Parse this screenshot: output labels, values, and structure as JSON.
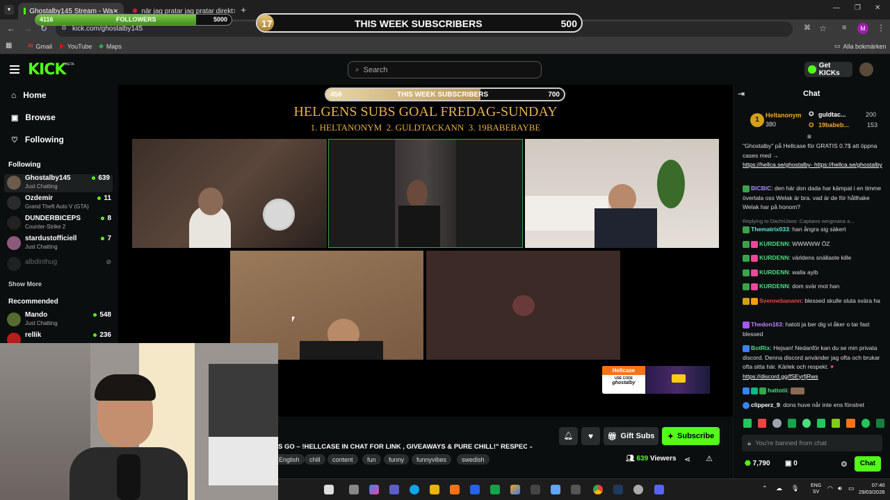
{
  "browser": {
    "tabs": [
      {
        "title": "Ghostalby145 Stream - Wa",
        "active": true
      },
      {
        "title": "när jag pratar jag pratar direkt",
        "active": false
      }
    ],
    "url": "kick.com/ghostalby145",
    "bookmarks": [
      "Gmail",
      "YouTube",
      "Maps"
    ],
    "all_bookmarks": "Alla bokmärken",
    "profile_initial": "M"
  },
  "overlay_top": {
    "followers_current": "4116",
    "followers_label": "FOLLOWERS",
    "followers_goal": "5000",
    "followers_progress": 0.82,
    "subs_current": "17",
    "subs_label": "THIS WEEK SUBSCRIBERS",
    "subs_goal": "500",
    "subs_progress": 0.034
  },
  "kick": {
    "logo": "KICK",
    "beta": "BETA",
    "search_placeholder": "Search",
    "get_kicks": "Get KICKs",
    "nav": [
      {
        "label": "Home",
        "icon": "home-icon"
      },
      {
        "label": "Browse",
        "icon": "browse-icon"
      },
      {
        "label": "Following",
        "icon": "heart-icon"
      }
    ],
    "following_heading": "Following",
    "following": [
      {
        "name": "Ghostalby145",
        "game": "Just Chatting",
        "viewers": "639"
      },
      {
        "name": "Ozdemir",
        "game": "Grand Theft Auto V (GTA)",
        "viewers": "11"
      },
      {
        "name": "DUNDERBICEPS",
        "game": "Counter-Strike 2",
        "viewers": "8"
      },
      {
        "name": "stardustofficiell",
        "game": "Just Chatting",
        "viewers": "7"
      },
      {
        "name": "albdinthug",
        "game": "",
        "viewers": ""
      }
    ],
    "show_more": "Show More",
    "recommended_heading": "Recommended",
    "recommended": [
      {
        "name": "Mando",
        "game": "Just Chatting",
        "viewers": "548"
      },
      {
        "name": "rellik",
        "game": "",
        "viewers": "236"
      }
    ]
  },
  "stream": {
    "subs_bar": {
      "current": "456",
      "label": "THIS WEEK SUBSCRIBERS",
      "goal": "700",
      "progress": 0.65
    },
    "goal_title": "HELGENS SUBS GOAL FREDAG-SUNDAY",
    "goal_ranking": "1. HELTANONYM  2. GULDTACKANN  3. 19BABEBAYBE",
    "hellcase_brand": "Hellcase",
    "hellcase_code_label": "USE CODE",
    "hellcase_code": "ghostalby"
  },
  "info": {
    "title": "S GO  –  !HELLCASE IN CHAT FOR LINK , GIVEAWAYS & PURE CHILL!\" RESPEC...",
    "tags": [
      "English",
      "chill",
      "content",
      "fun",
      "funny",
      "funnyvibes",
      "swedish"
    ],
    "gift_subs": "Gift Subs",
    "subscribe": "Subscribe",
    "viewers": "639",
    "viewers_label": "Viewers"
  },
  "chat": {
    "title": "Chat",
    "leaderboard": [
      {
        "rank": "1",
        "name": "Heltanonym",
        "value": "380"
      },
      {
        "name": "guldtac...",
        "value": "200"
      },
      {
        "name": "19babeb...",
        "value": "153"
      }
    ],
    "messages": [
      {
        "user": "",
        "text": "\"Ghostalby\" på Hellcase för GRATIS 0.7$ att öppna cases med →",
        "link": "https://hellca.se/ghostalby- https://hellca.se/ghostalby",
        "color": "#ffffff"
      },
      {
        "user": "BICBIC",
        "text": ": den här don dada har kämpat i en timme övertala oss Welak är bra. vad är de för hållhake Welak har på honom?",
        "color": "#a78bfa"
      },
      {
        "user": "",
        "reply": "Replying to DachriJaoo: Captiano wingmana a...",
        "text": ""
      },
      {
        "user": "Thematrix033",
        "text": ": han ångra sig säkert",
        "color": "#5eead4"
      },
      {
        "user": "KURDENN",
        "text": ": WWWWW ÖZ",
        "color": "#4ade80"
      },
      {
        "user": "KURDENN",
        "text": ": världens snällaste kille",
        "color": "#4ade80"
      },
      {
        "user": "KURDENN",
        "text": ": walla ayib",
        "color": "#4ade80"
      },
      {
        "user": "KURDENN",
        "text": ": dom svär mot han",
        "color": "#4ade80"
      },
      {
        "user": "Svennebanann",
        "text": ": blessed skulle sluta svära ha",
        "color": "#ef4444"
      },
      {
        "user": "Thedon163",
        "text": ": hatoti ja ber dig vi åker o tar fast blessed",
        "color": "#c084fc"
      },
      {
        "user": "BotRix",
        "text": ": Hejsan! Nedanför kan du se min privata discord. Denna discord använder jag ofta och brukar ofta sitta här. Kärlek och respekt.",
        "link": "https://discord.gg/fSEyrfjRws",
        "color": "#4ade80"
      },
      {
        "user": "hattotii",
        "text": ":",
        "color": "#4ade80"
      },
      {
        "user": "clipperz_9",
        "text": ": dons huve når inte ens fönstret",
        "color": "#ffffff"
      }
    ],
    "banned_text": "You're banned from chat",
    "points": "7,790",
    "redeem": "0",
    "chat_button": "Chat"
  },
  "taskbar": {
    "lang": "ENG",
    "lang2": "SV",
    "time": "07:40",
    "date": "29/03/2026"
  }
}
